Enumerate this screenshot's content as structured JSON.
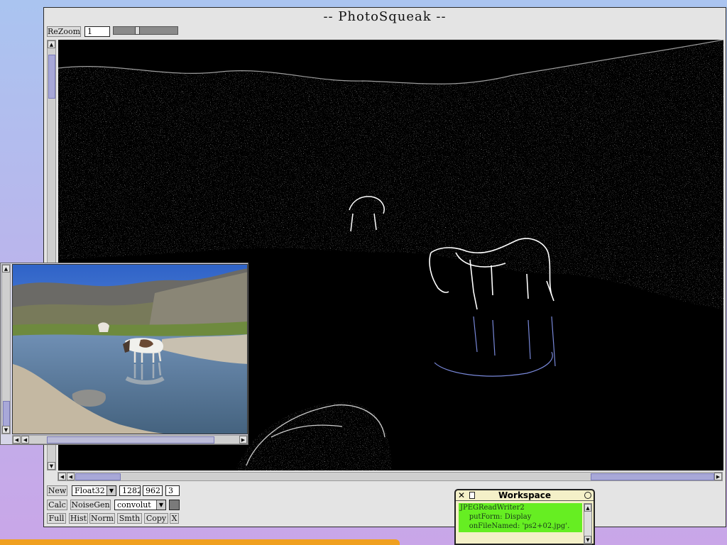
{
  "window": {
    "title": "-- PhotoSqueak --"
  },
  "top_bar": {
    "rezoom_label": "ReZoom",
    "zoom_value": "1"
  },
  "bottom_controls": {
    "row1": {
      "new_label": "New",
      "type_value": "Float32",
      "width_value": "1282",
      "height_value": "962",
      "channels_value": "3"
    },
    "row2": {
      "calc_label": "Calc",
      "noisegen_label": "NoiseGen",
      "op_value": "convolut"
    },
    "row3": {
      "full_label": "Full",
      "hist_label": "Hist",
      "norm_label": "Norm",
      "smth_label": "Smth",
      "copy_label": "Copy",
      "x_label": "X"
    }
  },
  "workspace": {
    "title": "Workspace",
    "code_lines": [
      "JPEGReadWriter2",
      "    putForm: Display",
      "    onFileNamed: 'ps2+02.jpg'."
    ]
  },
  "icons": {
    "up": "scroll-up-icon",
    "down": "scroll-down-icon",
    "left": "scroll-left-icon",
    "right": "scroll-right-icon",
    "dropdown": "chevron-down-icon",
    "close": "close-icon"
  },
  "colors": {
    "desktop_top": "#aac4f0",
    "desktop_bottom": "#c9a6e8",
    "workspace_code_bg": "#66ee22",
    "scroll_thumb": "#a8a8d8"
  }
}
